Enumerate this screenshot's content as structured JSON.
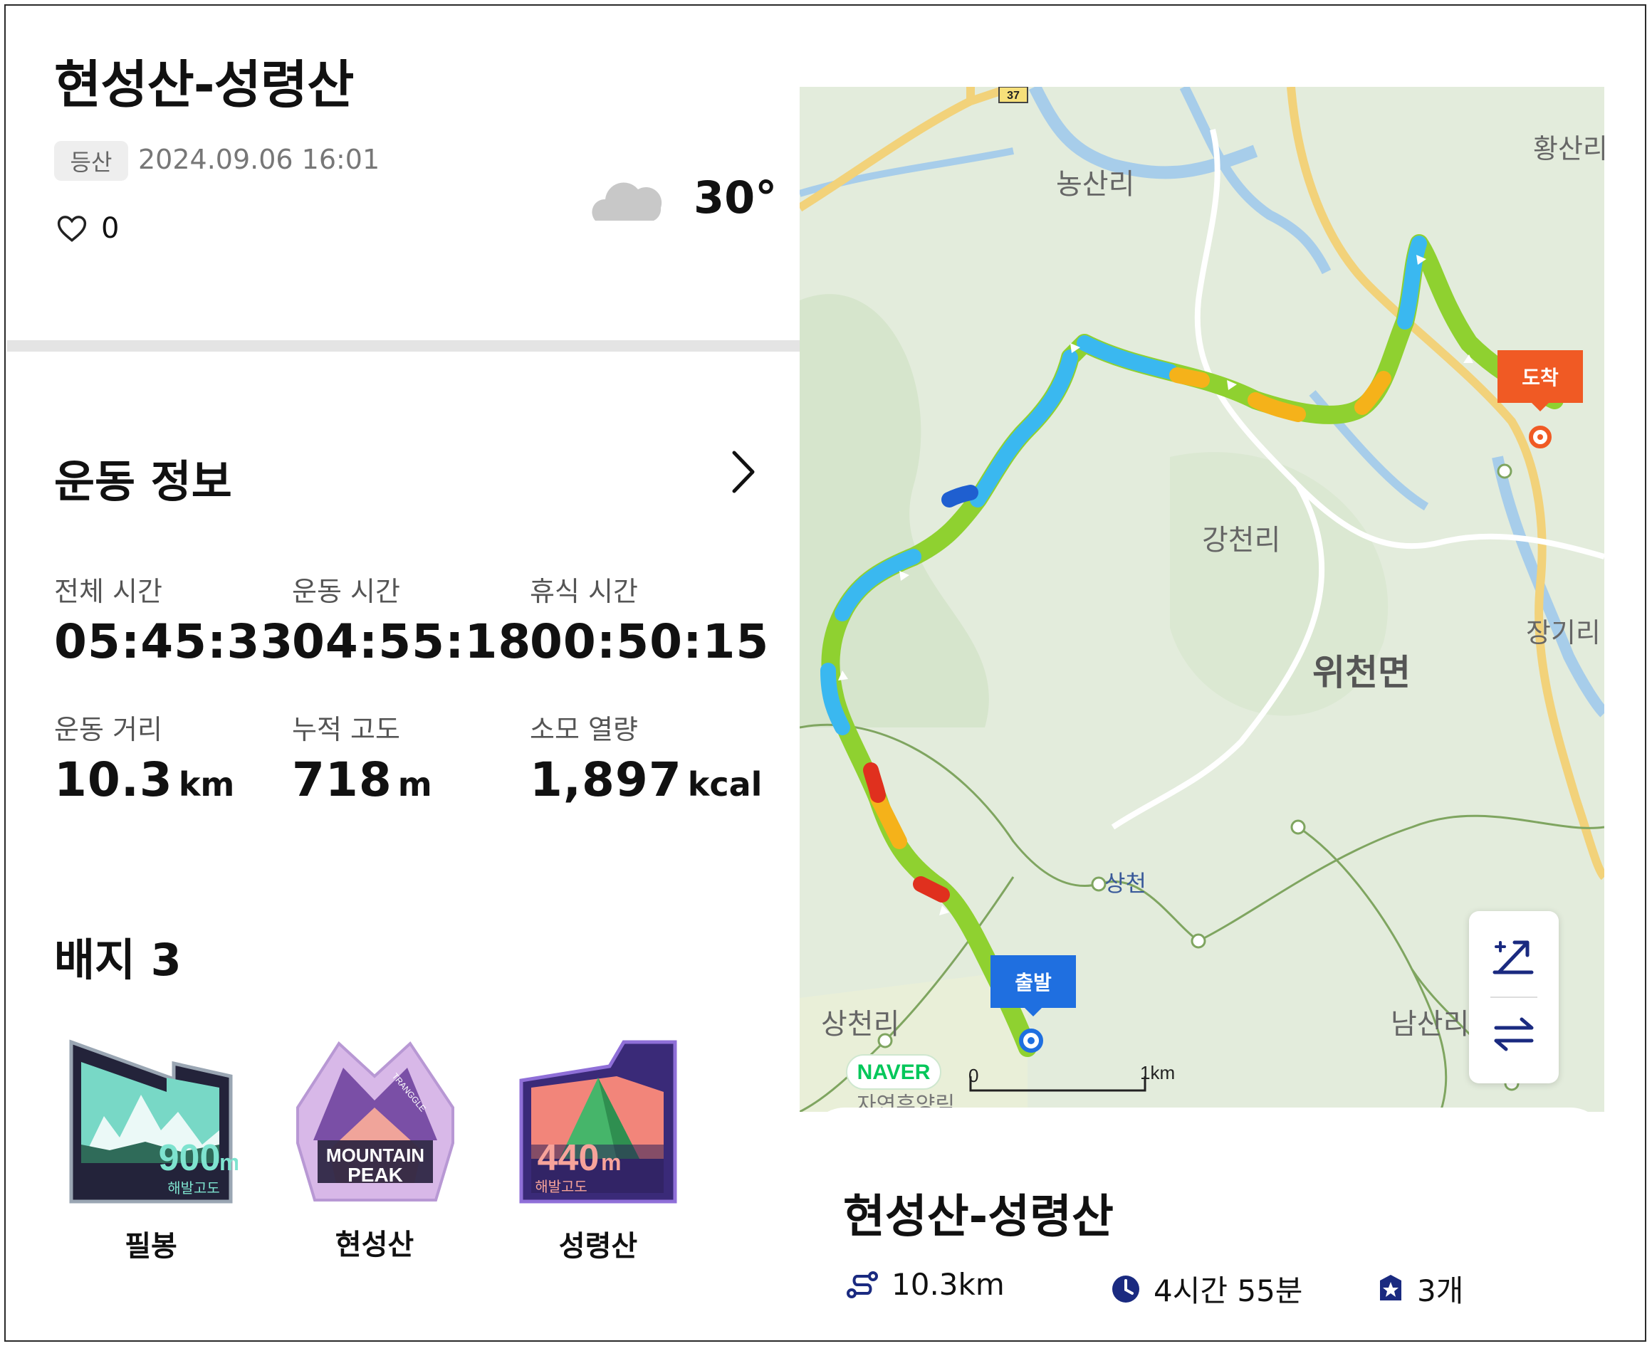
{
  "header": {
    "title": "현성산-성령산",
    "tag": "등산",
    "datetime": "2024.09.06 16:01",
    "likes": "0",
    "temperature": "30°"
  },
  "exercise": {
    "section_title": "운동 정보",
    "stats": [
      {
        "label": "전체 시간",
        "value": "05:45:33",
        "unit": ""
      },
      {
        "label": "운동 시간",
        "value": "04:55:18",
        "unit": ""
      },
      {
        "label": "휴식 시간",
        "value": "00:50:15",
        "unit": ""
      },
      {
        "label": "운동 거리",
        "value": "10.3",
        "unit": "km"
      },
      {
        "label": "누적 고도",
        "value": "718",
        "unit": "m"
      },
      {
        "label": "소모 열량",
        "value": "1,897",
        "unit": "kcal"
      }
    ]
  },
  "badges": {
    "section_title": "배지 3",
    "items": [
      {
        "name": "필봉",
        "value": "900",
        "unit": "m",
        "caption": "해발고도"
      },
      {
        "name": "현성산",
        "line1": "MOUNTAIN",
        "line2": "PEAK",
        "ring": "TRANGGLE"
      },
      {
        "name": "성령산",
        "value": "440",
        "unit": "m",
        "caption": "해발고도"
      }
    ]
  },
  "map": {
    "labels": {
      "nongsan": "농산리",
      "hwangsan": "황산리",
      "gangcheon": "강천리",
      "jangi": "장기리",
      "wicheon": "위천면",
      "sangcheon": "상천",
      "sangcheonri": "상천리",
      "namsan": "남산리",
      "bottom_partial": "자연휴양림",
      "road": "37"
    },
    "start_label": "출발",
    "end_label": "도착",
    "provider": "NAVER",
    "scale_start": "0",
    "scale_end": "1km"
  },
  "summary": {
    "title": "현성산-성령산",
    "distance": "10.3km",
    "duration": "4시간 55분",
    "badges": "3개"
  }
}
